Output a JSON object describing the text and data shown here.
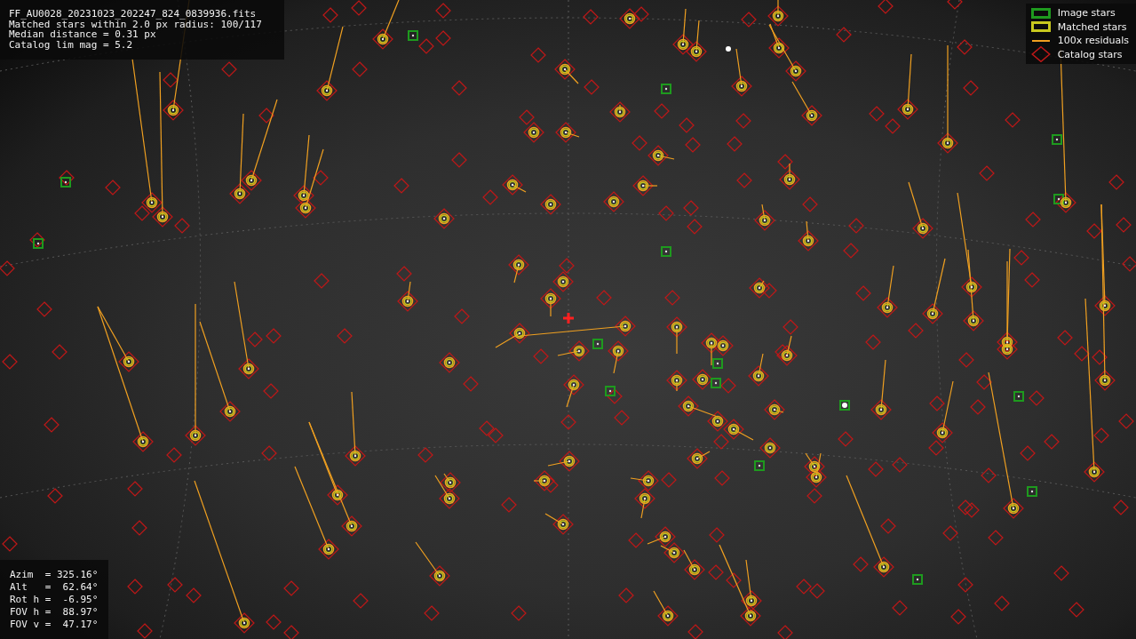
{
  "header": {
    "lines": [
      "FF_AU0028_20231023_202247_824_0839936.fits",
      "Matched stars within 2.0 px radius: 100/117",
      "Median distance = 0.31 px",
      "Catalog lim mag = 5.2"
    ]
  },
  "legend": {
    "items": [
      {
        "kind": "rect",
        "label": "Image stars",
        "color": "#1e9a1e"
      },
      {
        "kind": "rect",
        "label": "Matched stars",
        "color": "#c8c81e"
      },
      {
        "kind": "line",
        "label": "100x residuals",
        "color": "#f0a020"
      },
      {
        "kind": "diamond",
        "label": "Catalog stars",
        "color": "#c01818"
      }
    ]
  },
  "pointing": {
    "lines": [
      "Azim  = 325.16°",
      "Alt   =  62.64°",
      "Rot h =  -6.95°",
      "FOV h =  88.97°",
      "FOV v =  47.17°"
    ]
  }
}
